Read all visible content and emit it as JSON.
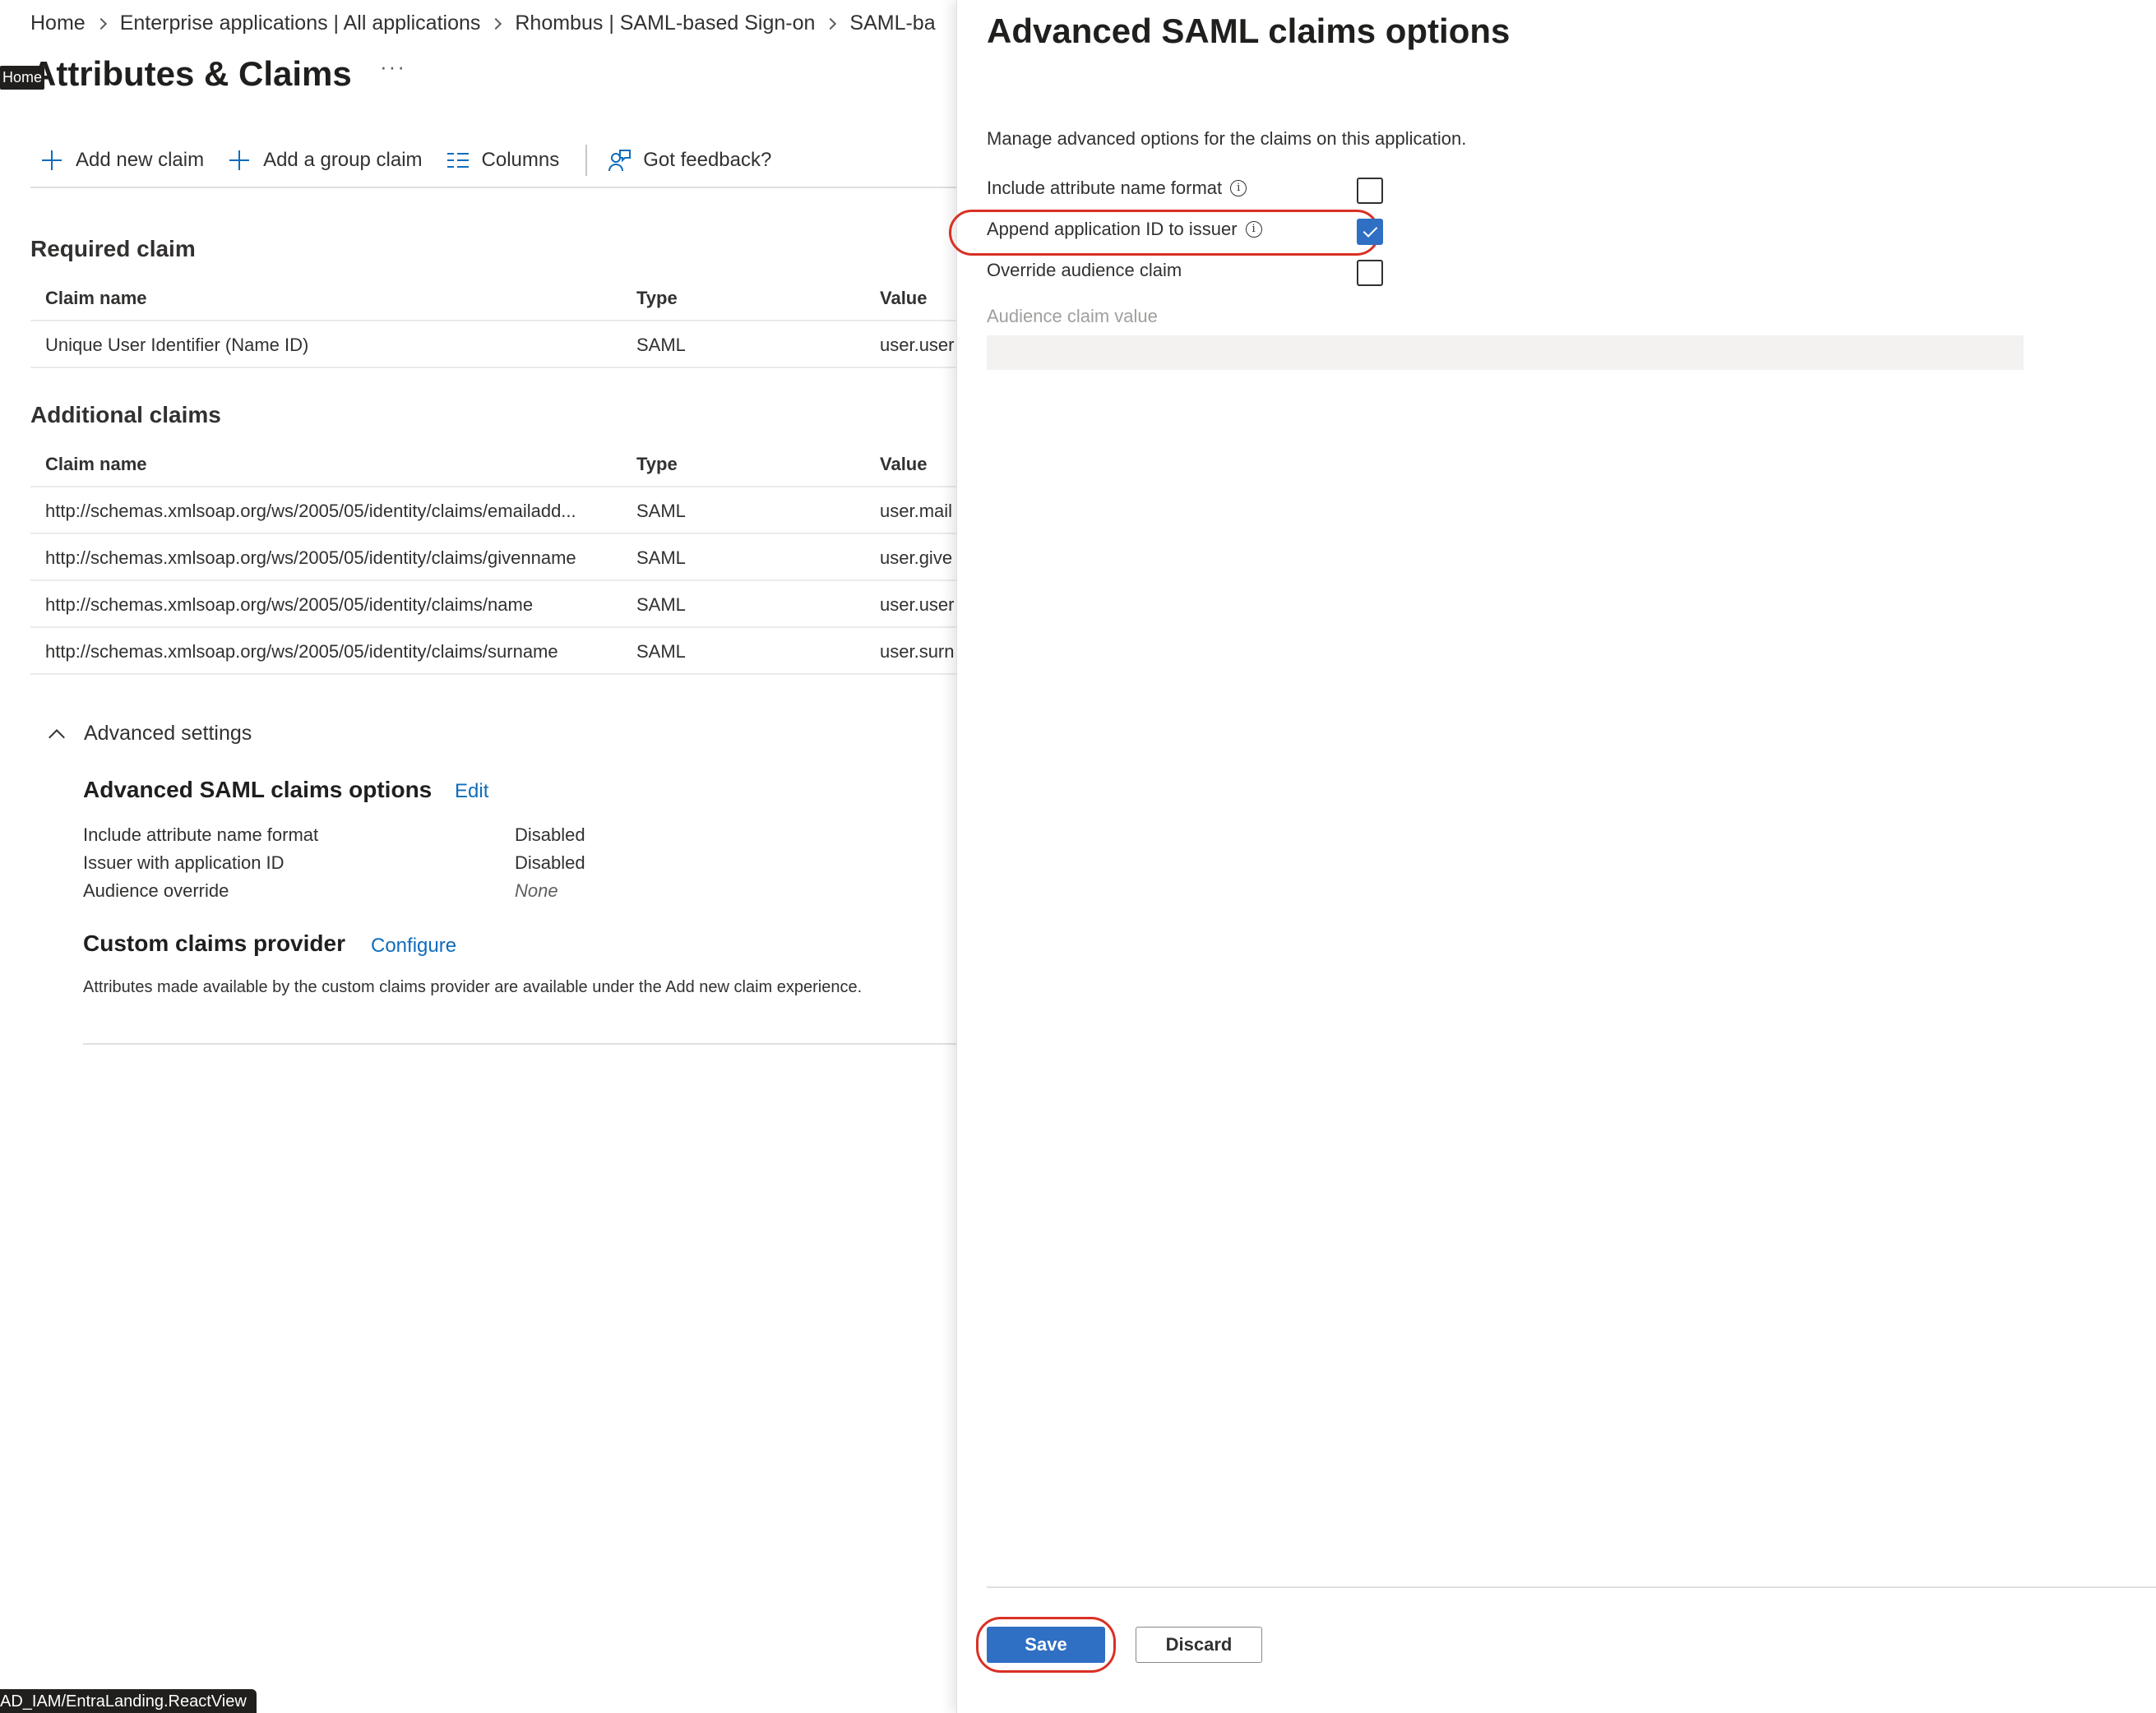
{
  "breadcrumb": {
    "items": [
      "Home",
      "Enterprise applications | All applications",
      "Rhombus | SAML-based Sign-on",
      "SAML-ba"
    ]
  },
  "tooltip": {
    "home": "Home"
  },
  "page": {
    "title": "Attributes & Claims",
    "more": "···"
  },
  "toolbar": {
    "add_new_claim": "Add new claim",
    "add_group_claim": "Add a group claim",
    "columns": "Columns",
    "got_feedback": "Got feedback?"
  },
  "required": {
    "title": "Required claim",
    "headers": {
      "name": "Claim name",
      "type": "Type",
      "value": "Value"
    },
    "rows": [
      {
        "name": "Unique User Identifier (Name ID)",
        "type": "SAML",
        "value": "user.user"
      }
    ]
  },
  "additional": {
    "title": "Additional claims",
    "headers": {
      "name": "Claim name",
      "type": "Type",
      "value": "Value"
    },
    "rows": [
      {
        "name": "http://schemas.xmlsoap.org/ws/2005/05/identity/claims/emailadd...",
        "type": "SAML",
        "value": "user.mail"
      },
      {
        "name": "http://schemas.xmlsoap.org/ws/2005/05/identity/claims/givenname",
        "type": "SAML",
        "value": "user.give"
      },
      {
        "name": "http://schemas.xmlsoap.org/ws/2005/05/identity/claims/name",
        "type": "SAML",
        "value": "user.user"
      },
      {
        "name": "http://schemas.xmlsoap.org/ws/2005/05/identity/claims/surname",
        "type": "SAML",
        "value": "user.surn"
      }
    ]
  },
  "advanced": {
    "toggle_label": "Advanced settings",
    "saml_title": "Advanced SAML claims options",
    "edit_label": "Edit",
    "items": [
      {
        "label": "Include attribute name format",
        "value": "Disabled"
      },
      {
        "label": "Issuer with application ID",
        "value": "Disabled"
      },
      {
        "label": "Audience override",
        "value": "None"
      }
    ],
    "custom_title": "Custom claims provider",
    "configure_label": "Configure",
    "custom_desc": "Attributes made available by the custom claims provider are available under the Add new claim experience."
  },
  "status_bar": {
    "url": "AD_IAM/EntraLanding.ReactView"
  },
  "panel": {
    "title": "Advanced SAML claims options",
    "description": "Manage advanced options for the claims on this application.",
    "options": [
      {
        "label": "Include attribute name format",
        "checked": false
      },
      {
        "label": "Append application ID to issuer",
        "checked": true
      },
      {
        "label": "Override audience claim",
        "checked": false
      }
    ],
    "audience_label": "Audience claim value",
    "audience_value": "",
    "save_label": "Save",
    "discard_label": "Discard",
    "highlight_color": "#d93025",
    "accent_color": "#2f6fc4"
  }
}
